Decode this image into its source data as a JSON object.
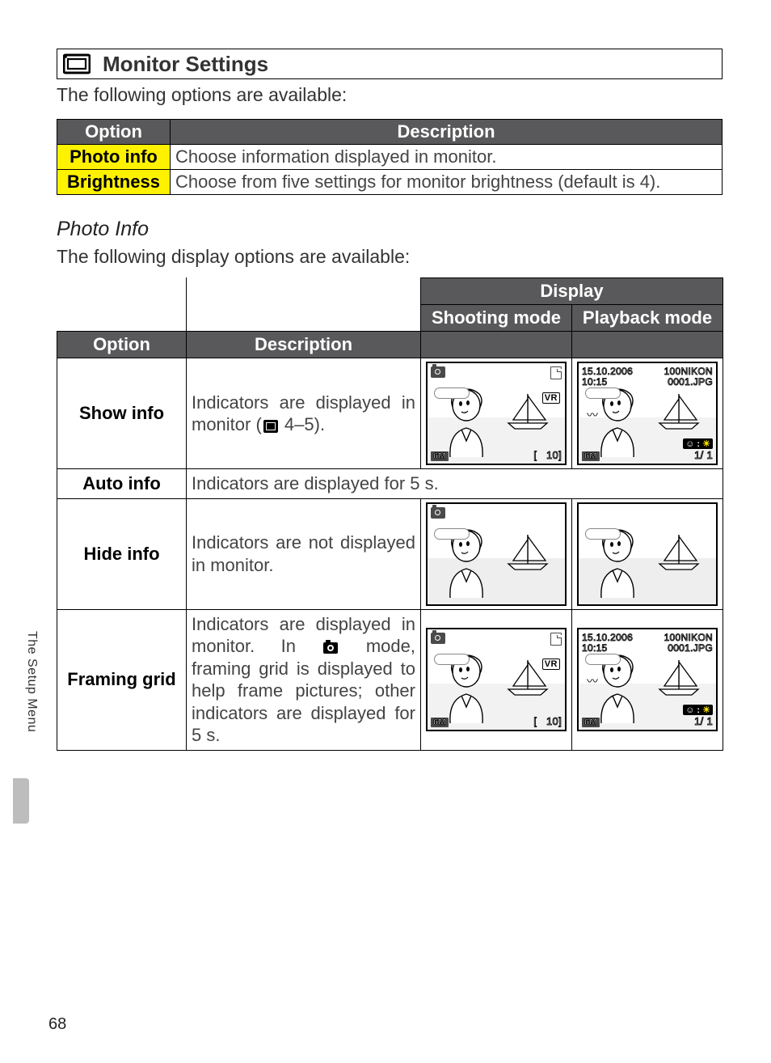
{
  "heading": {
    "title": "Monitor Settings"
  },
  "intro": "The following options are available:",
  "table1": {
    "headers": {
      "option": "Option",
      "description": "Description"
    },
    "rows": [
      {
        "option": "Photo info",
        "description": "Choose information displayed in monitor."
      },
      {
        "option": "Brightness",
        "description": "Choose from five settings for monitor brightness (default is 4)."
      }
    ]
  },
  "photo_info": {
    "subhead": "Photo Info",
    "intro": "The following display options are available:"
  },
  "table2": {
    "headers": {
      "option": "Option",
      "description": "Description",
      "display": "Display",
      "shooting": "Shooting mode",
      "playback": "Playback mode"
    },
    "rows": {
      "show": {
        "option": "Show info",
        "desc_pre": "Indicators are displayed in monitor (",
        "desc_ref": " 4–5).",
        "shoot_overlay": {
          "bl": "6M",
          "br_bracket_l": "[",
          "br_num": "10",
          "br_bracket_r": "]",
          "vr": "VR"
        },
        "play_overlay": {
          "tl1": "15.10.2006",
          "tl2": "10:15",
          "tr1": "100NIKON",
          "tr2": "0001.JPG",
          "bl": "6M",
          "br_top_badge": "☺ : ☀",
          "br_frac": "1/   1"
        }
      },
      "auto": {
        "option": "Auto info",
        "desc": "Indicators are displayed for 5 s."
      },
      "hide": {
        "option": "Hide info",
        "desc": "Indicators are not displayed in monitor."
      },
      "grid": {
        "option": "Framing grid",
        "desc_1": "Indicators are displayed in monitor. In ",
        "desc_2": " mode, framing grid is displayed to help frame pictures; other indicators are displayed for 5 s.",
        "shoot_overlay": {
          "bl": "6M",
          "br_bracket_l": "[",
          "br_num": "10",
          "br_bracket_r": "]",
          "vr": "VR"
        },
        "play_overlay": {
          "tl1": "15.10.2006",
          "tl2": "10:15",
          "tr1": "100NIKON",
          "tr2": "0001.JPG",
          "bl": "6M",
          "br_top_badge": "☺ : ☀",
          "br_frac": "1/   1"
        }
      }
    }
  },
  "side": {
    "tab": "The Setup Menu"
  },
  "page_number": "68"
}
